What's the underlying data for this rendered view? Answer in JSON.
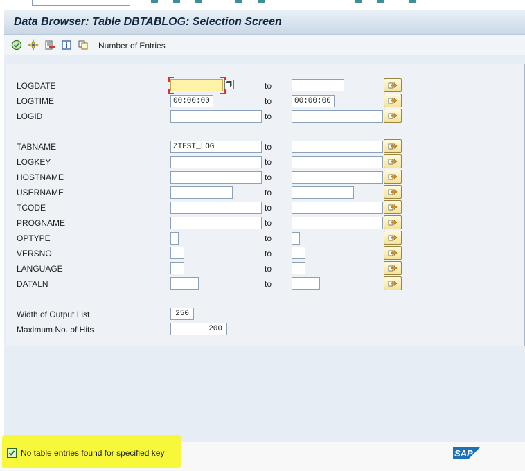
{
  "window": {
    "title": "Data Browser: Table DBTABLOG: Selection Screen"
  },
  "toolbar": {
    "number_of_entries_label": "Number of Entries"
  },
  "selection": {
    "to_label": "to",
    "fields": [
      {
        "label": "LOGDATE",
        "from": "",
        "to": ""
      },
      {
        "label": "LOGTIME",
        "from": "00:00:00",
        "to": "00:00:00"
      },
      {
        "label": "LOGID",
        "from": "",
        "to": ""
      },
      {
        "label": "TABNAME",
        "from": "ZTEST_LOG",
        "to": ""
      },
      {
        "label": "LOGKEY",
        "from": "",
        "to": ""
      },
      {
        "label": "HOSTNAME",
        "from": "",
        "to": ""
      },
      {
        "label": "USERNAME",
        "from": "",
        "to": ""
      },
      {
        "label": "TCODE",
        "from": "",
        "to": ""
      },
      {
        "label": "PROGNAME",
        "from": "",
        "to": ""
      },
      {
        "label": "OPTYPE",
        "from": "",
        "to": ""
      },
      {
        "label": "VERSNO",
        "from": "",
        "to": ""
      },
      {
        "label": "LANGUAGE",
        "from": "",
        "to": ""
      },
      {
        "label": "DATALN",
        "from": "",
        "to": ""
      }
    ]
  },
  "output": {
    "width_label": "Width of Output List",
    "width_value": "250",
    "max_hits_label": "Maximum No. of Hits",
    "max_hits_value": "200"
  },
  "status": {
    "message": "No table entries found for specified key",
    "type": "success",
    "highlight_color": "#f7f83a"
  },
  "brand": {
    "logo_text": "SAP",
    "logo_color": "#1a73b8"
  },
  "icons": [
    "execute-icon",
    "selection-options-icon",
    "delete-row-icon",
    "information-icon",
    "copy-icon",
    "multiple-selection-icon",
    "value-help-icon",
    "checkmark-icon"
  ]
}
